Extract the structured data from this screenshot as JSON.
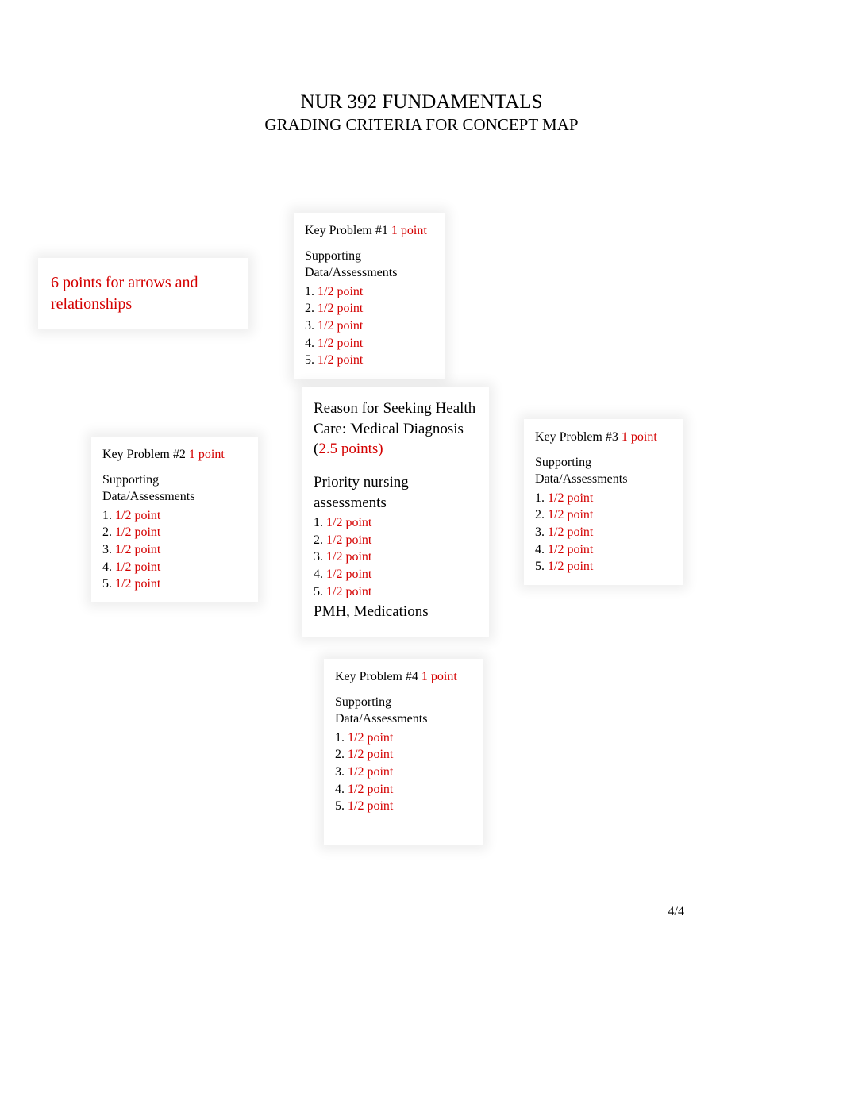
{
  "header": {
    "line1": "NUR 392 FUNDAMENTALS",
    "line2": "GRADING CRITERIA FOR CONCEPT MAP"
  },
  "arrows_note": "6 points for arrows and relationships",
  "center": {
    "reason_prefix": "Reason for Seeking Health Care: Medical Diagnosis (",
    "reason_points": "2.5 points)",
    "priority_label": "Priority nursing assessments",
    "items": {
      "n1": "1.",
      "p1": "1/2 point",
      "n2": "2.",
      "p2": "1/2 point",
      "n3": "3.",
      "p3": "1/2 point",
      "n4": "4.",
      "p4": "1/2 point",
      "n5": "5.",
      "p5": "1/2 point"
    },
    "pmh": "PMH, Medications"
  },
  "kp1": {
    "title": "Key Problem #1",
    "points": "1 point",
    "support_label": "Supporting Data/Assessments",
    "items": {
      "n1": "1.",
      "p1": "1/2 point",
      "n2": "2.",
      "p2": "1/2 point",
      "n3": "3.",
      "p3": "1/2 point",
      "n4": "4.",
      "p4": "1/2 point",
      "n5": "5.",
      "p5": "1/2 point"
    }
  },
  "kp2": {
    "title": "Key Problem #2",
    "points": "1 point",
    "support_label": "Supporting Data/Assessments",
    "items": {
      "n1": "1.",
      "p1": "1/2 point",
      "n2": "2.",
      "p2": "1/2 point",
      "n3": "3.",
      "p3": "1/2 point",
      "n4": "4.",
      "p4": "1/2 point",
      "n5": "5.",
      "p5": "1/2 point"
    }
  },
  "kp3": {
    "title": "Key Problem #3",
    "points": "1 point",
    "support_label": "Supporting Data/Assessments",
    "items": {
      "n1": "1.",
      "p1": "1/2 point",
      "n2": "2.",
      "p2": "1/2 point",
      "n3": "3.",
      "p3": "1/2 point",
      "n4": "4.",
      "p4": "1/2 point",
      "n5": "5.",
      "p5": "1/2 point"
    }
  },
  "kp4": {
    "title": "Key Problem #4",
    "points": "1 point",
    "support_label": "Supporting Data/Assessments",
    "items": {
      "n1": "1.",
      "p1": "1/2 point",
      "n2": "2.",
      "p2": "1/2 point",
      "n3": "3.",
      "p3": "1/2 point",
      "n4": "4.",
      "p4": "1/2 point",
      "n5": "5.",
      "p5": "1/2 point"
    }
  },
  "page_number": "4/4"
}
